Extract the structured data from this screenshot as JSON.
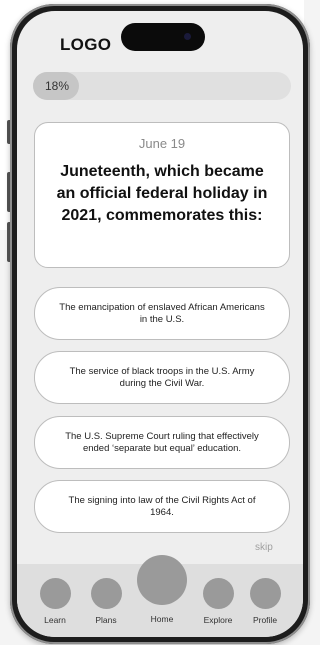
{
  "header": {
    "logo": "LOGO"
  },
  "progress": {
    "label": "18%",
    "value": 0.18
  },
  "question": {
    "date": "June 19",
    "text": "Juneteenth, which became an official federal holiday in 2021, commemorates this:"
  },
  "answers": [
    "The emancipation of enslaved African Americans in the U.S.",
    "The service of black troops in the U.S. Army during the Civil War.",
    "The U.S. Supreme Court ruling that effectively ended ‘separate but equal’ education.",
    "The signing into law of the Civil Rights Act of 1964."
  ],
  "skip_label": "skip",
  "nav": {
    "items": [
      {
        "label": "Learn"
      },
      {
        "label": "Plans"
      },
      {
        "label": "Home"
      },
      {
        "label": "Explore"
      },
      {
        "label": "Profile"
      }
    ]
  },
  "colors": {
    "frame": "#1d1d1d",
    "nav_bar": "#dedede",
    "nav_icon": "#9a9a9a",
    "card_border": "#bdbdbd"
  }
}
